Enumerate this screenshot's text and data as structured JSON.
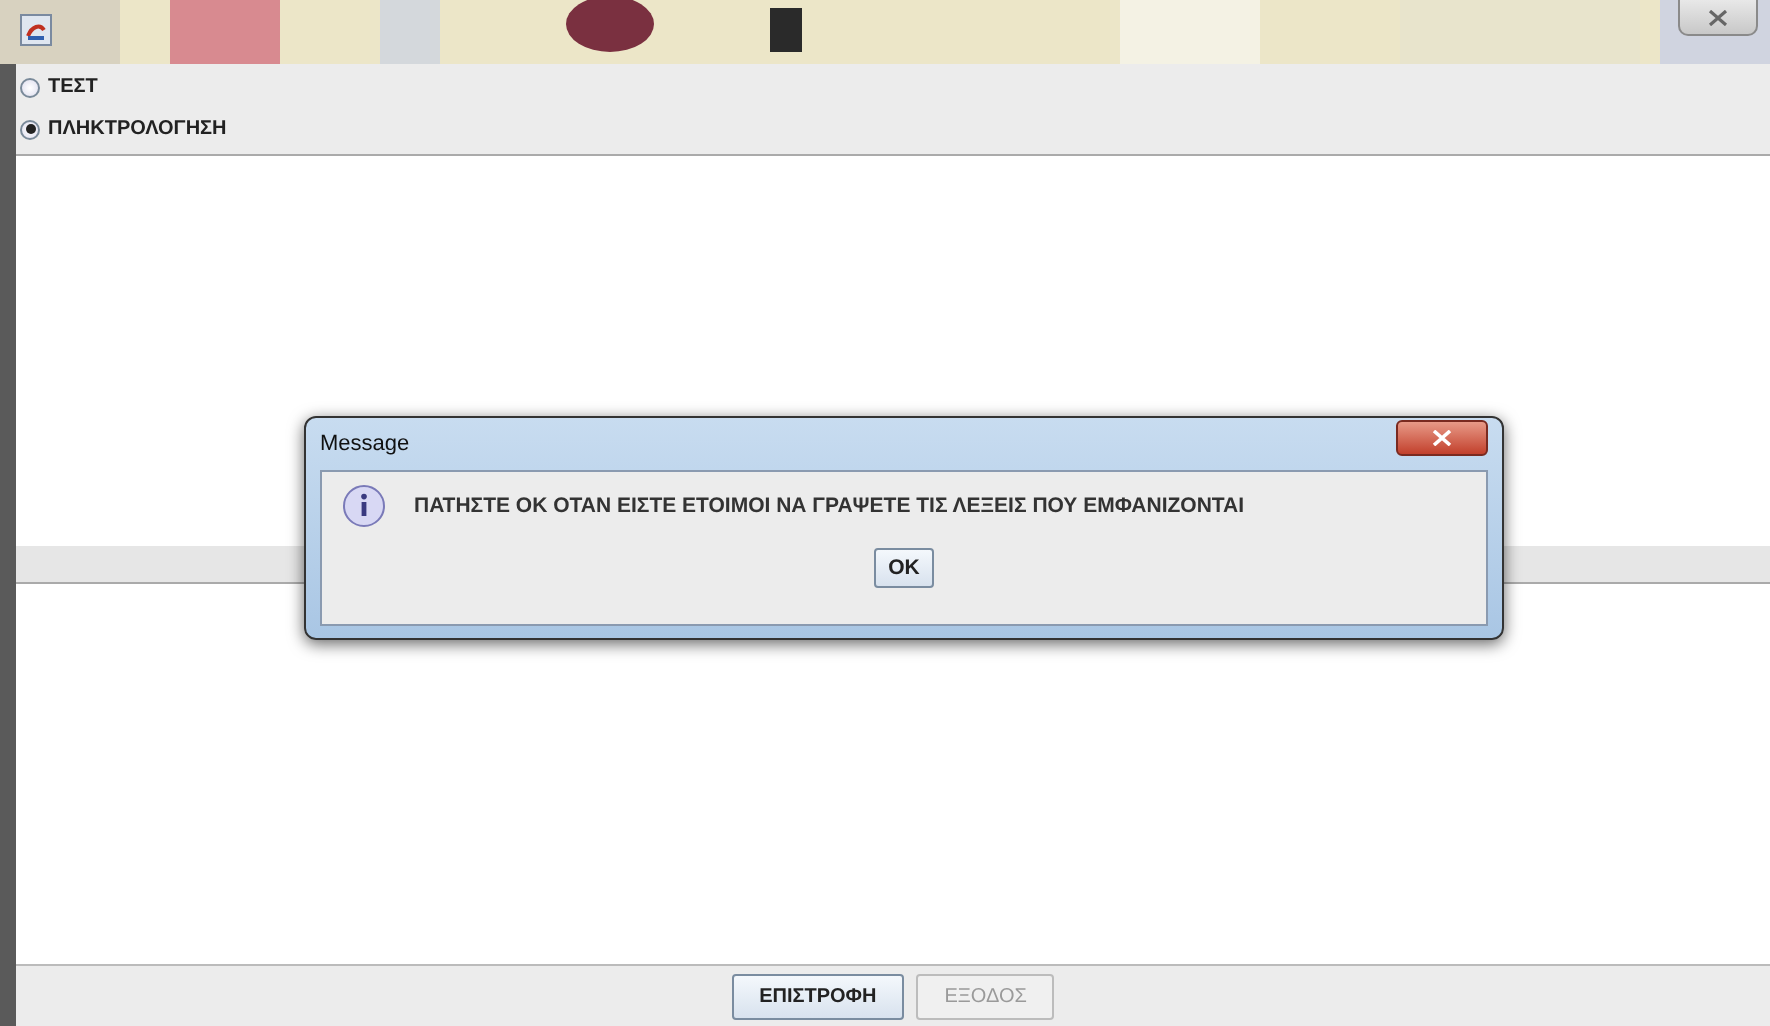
{
  "modes": [
    {
      "label": "ΤΕΣΤ",
      "selected": false
    },
    {
      "label": "ΠΛΗΚΤΡΟΛΟΓΗΣΗ",
      "selected": true
    }
  ],
  "buttons": [
    {
      "label": "ΕΠΙΣΤΡΟΦΗ",
      "disabled": false
    },
    {
      "label": "ΕΞΟΔΟΣ",
      "disabled": true
    }
  ],
  "dialog": {
    "title": "Message",
    "message": "ΠΑΤΗΣΤΕ ΟΚ ΟΤΑΝ ΕΙΣΤΕ ΕΤΟΙΜΟΙ ΝΑ ΓΡΑΨΕΤΕ ΤΙΣ ΛΕΞΕΙΣ ΠΟΥ ΕΜΦΑΝΙΖΟΝΤΑΙ",
    "button": "OK"
  }
}
